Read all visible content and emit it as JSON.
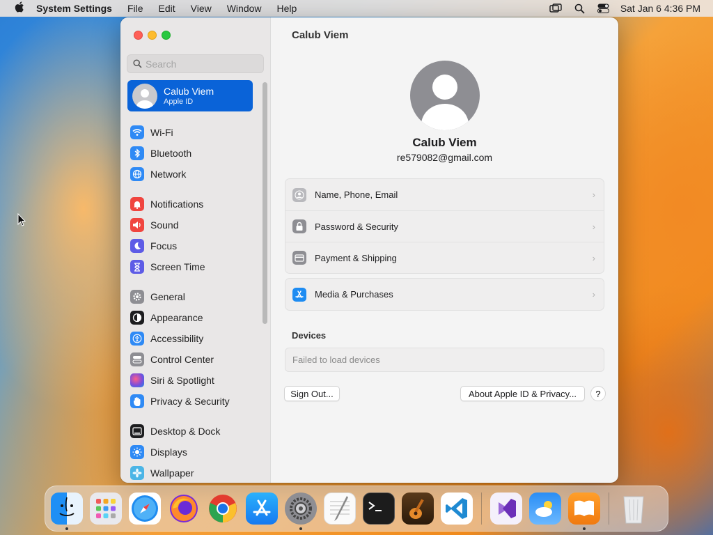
{
  "menubar": {
    "app_name": "System Settings",
    "items": [
      "File",
      "Edit",
      "View",
      "Window",
      "Help"
    ],
    "clock": "Sat Jan 6  4:36 PM"
  },
  "sidebar": {
    "search_placeholder": "Search",
    "profile": {
      "name": "Calub Viem",
      "subtitle": "Apple ID"
    },
    "items": [
      {
        "label": "Wi-Fi",
        "icon": "wifi-icon",
        "color": "#2f8af5"
      },
      {
        "label": "Bluetooth",
        "icon": "bluetooth-icon",
        "color": "#2f8af5"
      },
      {
        "label": "Network",
        "icon": "globe-icon",
        "color": "#2f8af5"
      },
      {
        "label": "Notifications",
        "icon": "bell-icon",
        "color": "#f0453f"
      },
      {
        "label": "Sound",
        "icon": "speaker-icon",
        "color": "#f0453f"
      },
      {
        "label": "Focus",
        "icon": "moon-icon",
        "color": "#5e5ce6"
      },
      {
        "label": "Screen Time",
        "icon": "hourglass-icon",
        "color": "#5e5ce6"
      },
      {
        "label": "General",
        "icon": "gear-icon",
        "color": "#8e8e93"
      },
      {
        "label": "Appearance",
        "icon": "appearance-icon",
        "color": "#1d1d1f"
      },
      {
        "label": "Accessibility",
        "icon": "accessibility-icon",
        "color": "#2f8af5"
      },
      {
        "label": "Control Center",
        "icon": "control-center-icon",
        "color": "#8e8e93"
      },
      {
        "label": "Siri & Spotlight",
        "icon": "siri-icon",
        "color": "#b34bd6"
      },
      {
        "label": "Privacy & Security",
        "icon": "hand-icon",
        "color": "#2f8af5"
      },
      {
        "label": "Desktop & Dock",
        "icon": "dock-icon",
        "color": "#1d1d1f"
      },
      {
        "label": "Displays",
        "icon": "sun-icon",
        "color": "#2f8af5"
      },
      {
        "label": "Wallpaper",
        "icon": "flower-icon",
        "color": "#4cb5e6"
      }
    ]
  },
  "main": {
    "title": "Calub Viem",
    "profile_name": "Calub Viem",
    "email": "re579082@gmail.com",
    "rows": [
      {
        "label": "Name, Phone, Email",
        "icon": "person-card-icon"
      },
      {
        "label": "Password & Security",
        "icon": "lock-icon"
      },
      {
        "label": "Payment & Shipping",
        "icon": "credit-card-icon"
      }
    ],
    "media_row": {
      "label": "Media & Purchases",
      "icon": "app-store-icon"
    },
    "devices_title": "Devices",
    "devices_status": "Failed to load devices",
    "sign_out": "Sign Out...",
    "about": "About Apple ID & Privacy...",
    "help": "?"
  },
  "dock": {
    "apps": [
      "finder-icon",
      "launchpad-icon",
      "safari-icon",
      "firefox-icon",
      "chrome-icon",
      "app-store-icon",
      "system-settings-icon",
      "textedit-icon",
      "terminal-icon",
      "garageband-icon",
      "vscode-icon",
      "visual-studio-icon",
      "weather-icon",
      "books-icon",
      "trash-icon"
    ]
  }
}
